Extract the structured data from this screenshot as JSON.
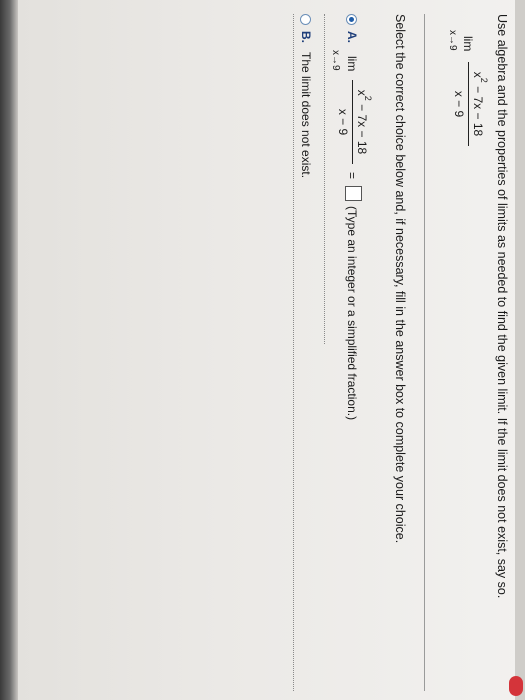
{
  "question": {
    "instruction": "Use algebra and the properties of limits as needed to find the given limit. If the limit does not exist, say so.",
    "limit_word": "lim",
    "limit_sub": "x→9",
    "numerator_base": "x",
    "numerator_exp": "2",
    "numerator_rest": " − 7x − 18",
    "denominator": "x − 9"
  },
  "prompt": "Select the correct choice below and, if necessary, fill in the answer box to complete your choice.",
  "choices": [
    {
      "letter": "A.",
      "selected": true,
      "limit_word": "lim",
      "limit_sub": "x→9",
      "numerator_base": "x",
      "numerator_exp": "2",
      "numerator_rest": " − 7x − 18",
      "denominator": "x − 9",
      "equals": "=",
      "answer_value": "",
      "hint": "(Type an integer or a simplified fraction.)"
    },
    {
      "letter": "B.",
      "selected": false,
      "text": "The limit does not exist."
    }
  ]
}
